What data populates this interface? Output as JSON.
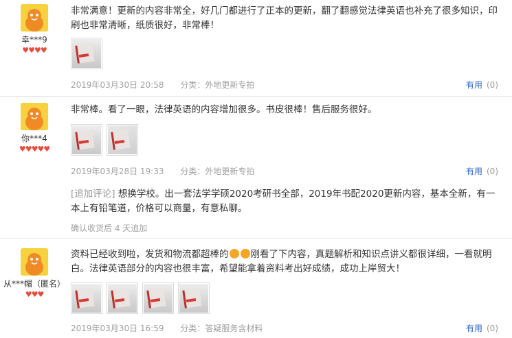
{
  "reviews": [
    {
      "user": "幸***9",
      "hearts": "♥♥♥♥",
      "content": "非常满意！更新的内容非常全，好几门都进行了正本的更新，翻了翻感觉法律英语也补充了很多知识，印刷也非常清晰，纸质很好，非常棒！",
      "date": "2019年03月30日 20:58",
      "category": "分类：外地更新专拍",
      "useful_label": "有用",
      "useful_count": "(0)"
    },
    {
      "user": "你***4",
      "hearts": "♥♥♥♥♥",
      "content": "非常棒。看了一眼，法律英语的内容增加很多。书皮很棒！售后服务很好。",
      "date": "2019年03月28日 19:33",
      "category": "分类：外地更新专拍",
      "useful_label": "有用",
      "useful_count": "(0)",
      "append_tag": "[追加评论]",
      "append_text": "想换学校。出一套法学学硕2020考研书全部，2019年书配2020更新内容，基本全新，有一本上有铅笔道，价格可以商量，有意私聊。",
      "append_meta": "确认收货后 4 天追加"
    },
    {
      "user": "从***帽（匿名）",
      "hearts": "♥♥♥",
      "content_a": "资料已经收到啦，发货和物流都超棒的",
      "content_b": "刚看了下内容，真题解析和知识点讲义都很详细，一看就明白。法律英语部分的内容也很丰富，希望能拿着资料考出好成绩，成功上岸贸大！",
      "date": "2019年03月30日 16:59",
      "category": "分类：答疑服务含材料",
      "useful_label": "有用",
      "useful_count": "(0)"
    }
  ],
  "colors": {
    "link": "#3366cc",
    "heart": "#e94c3d",
    "meta": "#a0a0a0",
    "avatar": "#f7d23e"
  },
  "icons": [
    "avatar-mascot-icon",
    "heart-icon",
    "emoji-icon"
  ]
}
